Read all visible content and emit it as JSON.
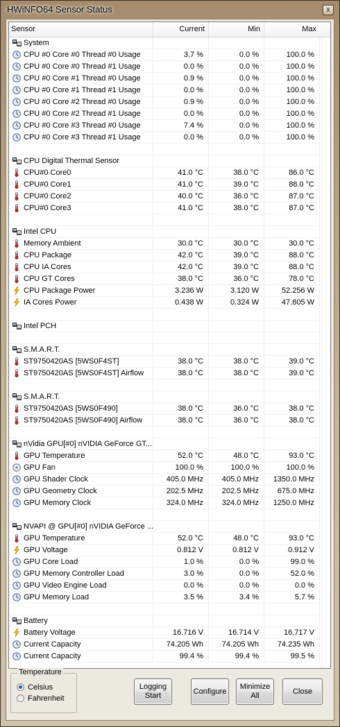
{
  "window": {
    "title": "HWiNFO64 Sensor Status",
    "close_glyph": "x"
  },
  "table": {
    "headers": [
      "Sensor",
      "Current",
      "Min",
      "Max"
    ],
    "rows": [
      {
        "kind": "group",
        "label": "System",
        "icon": "system-group-icon"
      },
      {
        "kind": "sensor",
        "icon": "clock-icon",
        "label": "CPU #0 Core #0 Thread #0 Usage",
        "cur": "3.7 %",
        "min": "0.0 %",
        "max": "100.0 %"
      },
      {
        "kind": "sensor",
        "icon": "clock-icon",
        "label": "CPU #0 Core #0 Thread #1 Usage",
        "cur": "0.0 %",
        "min": "0.0 %",
        "max": "100.0 %"
      },
      {
        "kind": "sensor",
        "icon": "clock-icon",
        "label": "CPU #0 Core #1 Thread #0 Usage",
        "cur": "0.9 %",
        "min": "0.0 %",
        "max": "100.0 %"
      },
      {
        "kind": "sensor",
        "icon": "clock-icon",
        "label": "CPU #0 Core #1 Thread #1 Usage",
        "cur": "0.0 %",
        "min": "0.0 %",
        "max": "100.0 %"
      },
      {
        "kind": "sensor",
        "icon": "clock-icon",
        "label": "CPU #0 Core #2 Thread #0 Usage",
        "cur": "0.9 %",
        "min": "0.0 %",
        "max": "100.0 %"
      },
      {
        "kind": "sensor",
        "icon": "clock-icon",
        "label": "CPU #0 Core #2 Thread #1 Usage",
        "cur": "0.0 %",
        "min": "0.0 %",
        "max": "100.0 %"
      },
      {
        "kind": "sensor",
        "icon": "clock-icon",
        "label": "CPU #0 Core #3 Thread #0 Usage",
        "cur": "7.4 %",
        "min": "0.0 %",
        "max": "100.0 %"
      },
      {
        "kind": "sensor",
        "icon": "clock-icon",
        "label": "CPU #0 Core #3 Thread #1 Usage",
        "cur": "0.0 %",
        "min": "0.0 %",
        "max": "100.0 %"
      },
      {
        "kind": "spacer"
      },
      {
        "kind": "group",
        "label": "CPU Digital Thermal Sensor",
        "icon": "system-group-icon"
      },
      {
        "kind": "sensor",
        "icon": "thermometer-icon",
        "label": "CPU#0 Core0",
        "cur": "41.0 °C",
        "min": "38.0 °C",
        "max": "86.0 °C"
      },
      {
        "kind": "sensor",
        "icon": "thermometer-icon",
        "label": "CPU#0 Core1",
        "cur": "41.0 °C",
        "min": "39.0 °C",
        "max": "88.0 °C"
      },
      {
        "kind": "sensor",
        "icon": "thermometer-icon",
        "label": "CPU#0 Core2",
        "cur": "40.0 °C",
        "min": "36.0 °C",
        "max": "87.0 °C"
      },
      {
        "kind": "sensor",
        "icon": "thermometer-icon",
        "label": "CPU#0 Core3",
        "cur": "41.0 °C",
        "min": "38.0 °C",
        "max": "87.0 °C"
      },
      {
        "kind": "spacer"
      },
      {
        "kind": "group",
        "label": "Intel CPU",
        "icon": "system-group-icon"
      },
      {
        "kind": "sensor",
        "icon": "thermometer-icon",
        "label": "Memory Ambient",
        "cur": "30.0 °C",
        "min": "30.0 °C",
        "max": "30.0 °C"
      },
      {
        "kind": "sensor",
        "icon": "thermometer-icon",
        "label": "CPU Package",
        "cur": "42.0 °C",
        "min": "39.0 °C",
        "max": "88.0 °C"
      },
      {
        "kind": "sensor",
        "icon": "thermometer-icon",
        "label": "CPU IA Cores",
        "cur": "42.0 °C",
        "min": "39.0 °C",
        "max": "88.0 °C"
      },
      {
        "kind": "sensor",
        "icon": "thermometer-icon",
        "label": "CPU GT Cores",
        "cur": "38.0 °C",
        "min": "36.0 °C",
        "max": "78.0 °C"
      },
      {
        "kind": "sensor",
        "icon": "lightning-icon",
        "label": "CPU Package Power",
        "cur": "3.236 W",
        "min": "3.120 W",
        "max": "52.256 W"
      },
      {
        "kind": "sensor",
        "icon": "lightning-icon",
        "label": "IA Cores Power",
        "cur": "0.438 W",
        "min": "0.324 W",
        "max": "47.805 W"
      },
      {
        "kind": "spacer"
      },
      {
        "kind": "group",
        "label": "Intel PCH",
        "icon": "system-group-icon"
      },
      {
        "kind": "spacer"
      },
      {
        "kind": "group",
        "label": "S.M.A.R.T.",
        "icon": "system-group-icon"
      },
      {
        "kind": "sensor",
        "icon": "thermometer-icon",
        "label": "ST9750420AS [5WS0F4ST]",
        "cur": "38.0 °C",
        "min": "38.0 °C",
        "max": "39.0 °C"
      },
      {
        "kind": "sensor",
        "icon": "thermometer-icon",
        "label": "ST9750420AS [5WS0F4ST] Airflow",
        "cur": "38.0 °C",
        "min": "38.0 °C",
        "max": "39.0 °C"
      },
      {
        "kind": "spacer"
      },
      {
        "kind": "group",
        "label": "S.M.A.R.T.",
        "icon": "system-group-icon"
      },
      {
        "kind": "sensor",
        "icon": "thermometer-icon",
        "label": "ST9750420AS [5WS0F490]",
        "cur": "38.0 °C",
        "min": "36.0 °C",
        "max": "38.0 °C"
      },
      {
        "kind": "sensor",
        "icon": "thermometer-icon",
        "label": "ST9750420AS [5WS0F490] Airflow",
        "cur": "38.0 °C",
        "min": "36.0 °C",
        "max": "38.0 °C"
      },
      {
        "kind": "spacer"
      },
      {
        "kind": "group",
        "label": "nVidia GPU[#0] nVIDIA GeForce GT...",
        "icon": "system-group-icon"
      },
      {
        "kind": "sensor",
        "icon": "thermometer-icon",
        "label": "GPU Temperature",
        "cur": "52.0 °C",
        "min": "48.0 °C",
        "max": "93.0 °C"
      },
      {
        "kind": "sensor",
        "icon": "disc-icon",
        "label": "GPU Fan",
        "cur": "100.0 %",
        "min": "100.0 %",
        "max": "100.0 %"
      },
      {
        "kind": "sensor",
        "icon": "clock-icon",
        "label": "GPU Shader Clock",
        "cur": "405.0 MHz",
        "min": "405.0 MHz",
        "max": "1350.0 MHz"
      },
      {
        "kind": "sensor",
        "icon": "clock-icon",
        "label": "GPU Geometry Clock",
        "cur": "202.5 MHz",
        "min": "202.5 MHz",
        "max": "675.0 MHz"
      },
      {
        "kind": "sensor",
        "icon": "clock-icon",
        "label": "GPU Memory Clock",
        "cur": "324.0 MHz",
        "min": "324.0 MHz",
        "max": "1250.0 MHz"
      },
      {
        "kind": "spacer"
      },
      {
        "kind": "group",
        "label": "NVAPI @ GPU[#0] nVIDIA GeForce ...",
        "icon": "system-group-icon"
      },
      {
        "kind": "sensor",
        "icon": "thermometer-icon",
        "label": "GPU Temperature",
        "cur": "52.0 °C",
        "min": "48.0 °C",
        "max": "93.0 °C"
      },
      {
        "kind": "sensor",
        "icon": "lightning-icon",
        "label": "GPU Voltage",
        "cur": "0.812 V",
        "min": "0.812 V",
        "max": "0.912 V"
      },
      {
        "kind": "sensor",
        "icon": "clock-icon",
        "label": "GPU Core Load",
        "cur": "1.0 %",
        "min": "0.0 %",
        "max": "99.0 %"
      },
      {
        "kind": "sensor",
        "icon": "clock-icon",
        "label": "GPU Memory Controller Load",
        "cur": "3.0 %",
        "min": "0.0 %",
        "max": "52.0 %"
      },
      {
        "kind": "sensor",
        "icon": "clock-icon",
        "label": "GPU Video Engine Load",
        "cur": "0.0 %",
        "min": "0.0 %",
        "max": "0.0 %"
      },
      {
        "kind": "sensor",
        "icon": "clock-icon",
        "label": "GPU Memory Load",
        "cur": "3.5 %",
        "min": "3.4 %",
        "max": "5.7 %"
      },
      {
        "kind": "spacer"
      },
      {
        "kind": "group",
        "label": "Battery",
        "icon": "system-group-icon"
      },
      {
        "kind": "sensor",
        "icon": "lightning-icon",
        "label": "Battery Voltage",
        "cur": "16.716 V",
        "min": "16.714 V",
        "max": "16.717 V"
      },
      {
        "kind": "sensor",
        "icon": "clock-icon",
        "label": "Current Capacity",
        "cur": "74.205 Wh",
        "min": "74.205 Wh",
        "max": "74.235 Wh"
      },
      {
        "kind": "sensor",
        "icon": "clock-icon",
        "label": "Current Capacity",
        "cur": "99.4 %",
        "min": "99.4 %",
        "max": "99.5 %"
      }
    ]
  },
  "temperature": {
    "legend": "Temperature",
    "options": [
      {
        "label": "Celsius",
        "selected": true
      },
      {
        "label": "Fahrenheit",
        "selected": false
      }
    ]
  },
  "buttons": {
    "logging_line1": "Logging",
    "logging_line2": "Start",
    "configure": "Configure",
    "minimize_line1": "Minimize",
    "minimize_line2": "All",
    "close": "Close"
  },
  "colors": {
    "title_bar": "#a58b6c",
    "window_body": "#ece9e0",
    "icon_blue": "#3b6ab0",
    "icon_red": "#c0282d",
    "icon_yellow": "#f2c21a"
  }
}
